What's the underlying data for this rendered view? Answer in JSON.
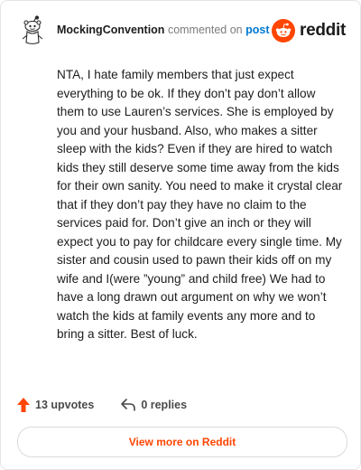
{
  "comment": {
    "author": "MockingConvention",
    "action_text": "commented on",
    "post_link_label": "post",
    "body": "NTA, I hate family members that just expect everything to be ok. If they don’t pay don’t allow them to use Lauren’s services. She is employed by you and your husband. Also, who makes a sitter sleep with the kids? Even if they are hired to watch kids they still deserve some time away from the kids for their own sanity. You need to make it crystal clear that if they don’t pay they have no claim to the services paid for. Don’t give an inch or they will expect you to pay for childcare every single time. My sister and cousin used to pawn their kids off on my wife and I(were ”young” and child free) We had to have a long drawn out argument on why we won’t watch the kids at family events any more and to bring a sitter. Best of luck.",
    "upvotes_label": "13 upvotes",
    "replies_label": "0 replies"
  },
  "brand": {
    "name": "reddit",
    "icon": "reddit-snoo-icon",
    "color": "#ff4500"
  },
  "icons": {
    "avatar": "snoo-avatar-icon",
    "upvote": "upvote-arrow-icon",
    "reply": "reply-arrow-icon"
  },
  "actions": {
    "view_more_label": "View more on Reddit"
  },
  "colors": {
    "accent": "#ff4500",
    "link": "#0079d3",
    "text": "#1c1c1c",
    "muted": "#7c7c7c"
  }
}
